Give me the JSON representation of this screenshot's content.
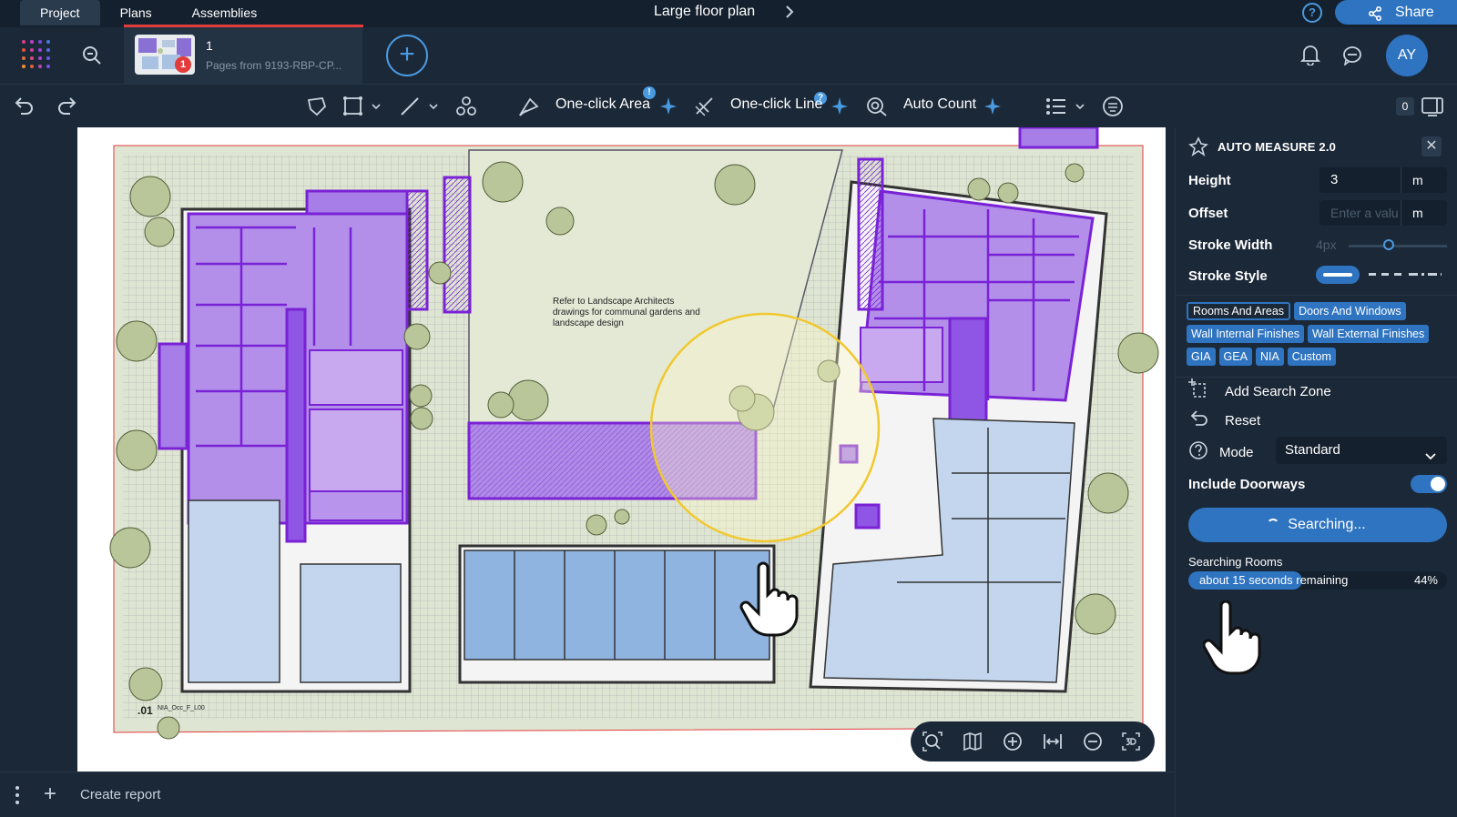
{
  "tabs": [
    {
      "label": "Project"
    },
    {
      "label": "Plans"
    },
    {
      "label": "Assemblies"
    }
  ],
  "document": {
    "title": "Large floor plan"
  },
  "share": {
    "label": "Share"
  },
  "page_info": {
    "number": "1",
    "subtitle": "Pages from 9193-RBP-CP...",
    "badge": "1"
  },
  "user": {
    "initials": "AY"
  },
  "toolbar": {
    "one_click_area": "One-click Area",
    "one_click_area_badge": "!",
    "one_click_line": "One-click Line",
    "one_click_line_badge": "?",
    "auto_count": "Auto Count",
    "count_badge": "0"
  },
  "plan_note": "Refer to Landscape Architects drawings for communal gardens and landscape design",
  "plan_label": "NIA_Occ_F_L00",
  "plan_code": ".01",
  "panel": {
    "title": "AUTO MEASURE 2.0",
    "height_label": "Height",
    "height_value": "3",
    "height_unit": "m",
    "offset_label": "Offset",
    "offset_placeholder": "Enter a valu",
    "offset_unit": "m",
    "stroke_width_label": "Stroke Width",
    "stroke_width_value": "4px",
    "stroke_style_label": "Stroke Style",
    "chips": [
      "Rooms And Areas",
      "Doors And Windows",
      "Wall Internal Finishes",
      "Wall External Finishes",
      "GIA",
      "GEA",
      "NIA",
      "Custom"
    ],
    "add_search_zone": "Add Search Zone",
    "reset": "Reset",
    "mode_label": "Mode",
    "mode_value": "Standard",
    "include_doorways_label": "Include Doorways",
    "search_button": "Searching...",
    "status_label": "Searching Rooms",
    "progress_text": "about 15 seconds remaining",
    "progress_percent": "44%",
    "progress_value": 0.44
  },
  "bottom": {
    "create_report": "Create report"
  },
  "colors": {
    "accent": "#2f74c0",
    "purple_fill": "#a77de8",
    "purple_stroke": "#7a22d6",
    "blue_room": "#8fb4e0",
    "tree": "#b8c69a",
    "tab_underline": "#e23b3b"
  }
}
